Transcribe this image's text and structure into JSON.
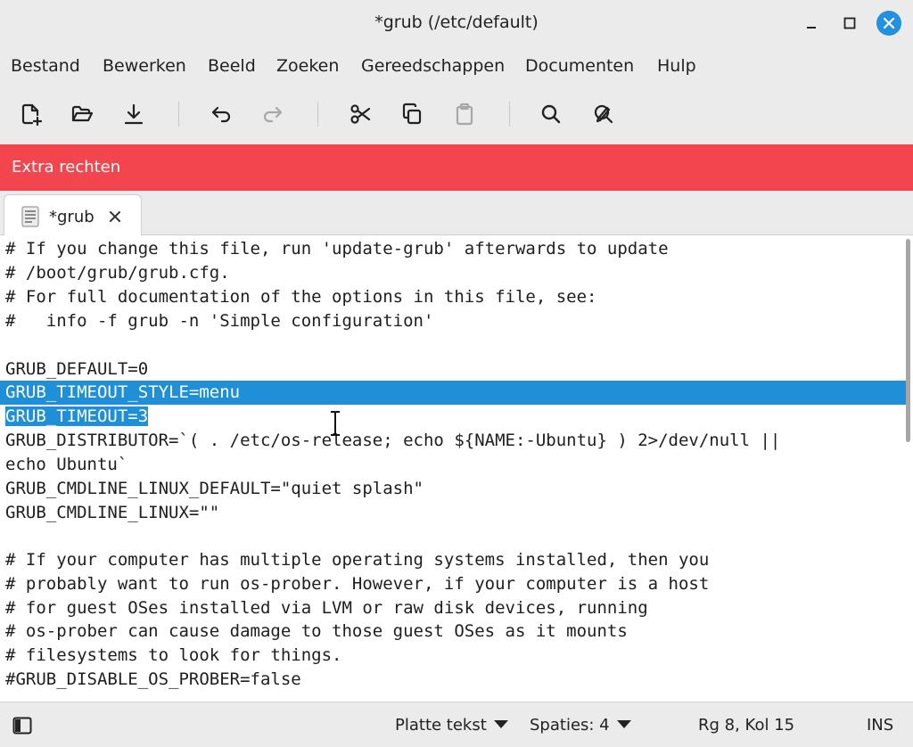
{
  "window": {
    "title": "*grub (/etc/default)"
  },
  "menubar": {
    "items": [
      "Bestand",
      "Bewerken",
      "Beeld",
      "Zoeken",
      "Gereedschappen",
      "Documenten",
      "Hulp"
    ]
  },
  "toolbar": {
    "icons": [
      "new-document-icon",
      "open-folder-icon",
      "save-download-icon",
      "undo-icon",
      "redo-icon",
      "cut-icon",
      "copy-icon",
      "paste-icon",
      "search-icon",
      "search-replace-icon"
    ]
  },
  "infobar": {
    "text": "Extra rechten",
    "color": "#f2454d"
  },
  "tab": {
    "label": "*grub"
  },
  "editor": {
    "lines": [
      "# If you change this file, run 'update-grub' afterwards to update",
      "# /boot/grub/grub.cfg.",
      "# For full documentation of the options in this file, see:",
      "#   info -f grub -n 'Simple configuration'",
      "",
      "GRUB_DEFAULT=0",
      "GRUB_TIMEOUT_STYLE=menu",
      "GRUB_TIMEOUT=3",
      "GRUB_DISTRIBUTOR=`( . /etc/os-release; echo ${NAME:-Ubuntu} ) 2>/dev/null ||",
      "echo Ubuntu`",
      "GRUB_CMDLINE_LINUX_DEFAULT=\"quiet splash\"",
      "GRUB_CMDLINE_LINUX=\"\"",
      "",
      "# If your computer has multiple operating systems installed, then you",
      "# probably want to run os-prober. However, if your computer is a host",
      "# for guest OSes installed via LVM or raw disk devices, running",
      "# os-prober can cause damage to those guest OSes as it mounts",
      "# filesystems to look for things.",
      "#GRUB_DISABLE_OS_PROBER=false"
    ],
    "selection_color": "#1f8fd8"
  },
  "statusbar": {
    "syntax": "Platte tekst",
    "indent": "Spaties: 4",
    "position": "Rg 8, Kol 15",
    "mode": "INS"
  }
}
